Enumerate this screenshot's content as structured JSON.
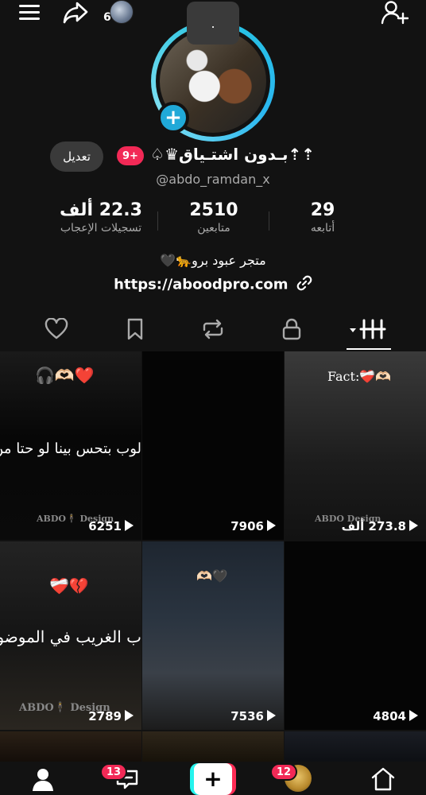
{
  "topbar": {
    "menu_icon": "hamburger-menu-icon",
    "share_icon": "share-arrow-icon",
    "visitor_count": "6",
    "add_user_icon": "add-user-icon"
  },
  "note_bubble": {
    "text": "."
  },
  "profile": {
    "display_name": "⇡⇡بـدون اشتـياق♛♤",
    "username": "@abdo_ramdan_x",
    "edit_label": "تعديل",
    "badge": "9+",
    "bio": "متجر عبود برو🐆🖤",
    "link": "https://aboodpro.com"
  },
  "stats": {
    "likes": {
      "value": "22.3 ألف",
      "label": "تسجيلات الإعجاب"
    },
    "followers": {
      "value": "2510",
      "label": "متابعين"
    },
    "following": {
      "value": "29",
      "label": "أتابعه"
    }
  },
  "tabs": [
    {
      "icon": "heart-icon"
    },
    {
      "icon": "bookmark-icon"
    },
    {
      "icon": "repost-icon"
    },
    {
      "icon": "lock-icon"
    },
    {
      "icon": "grid-videos-icon"
    }
  ],
  "videos": [
    {
      "overlay": "🎧🫶🏻❤️",
      "text": "لوب بتحس بينا لو حتا من",
      "watermark": "ABDO🕴 Design",
      "views": "6251"
    },
    {
      "overlay": "",
      "text": "",
      "watermark": "",
      "views": "7906"
    },
    {
      "overlay": "Fact:❤️‍🩹🫶🏻",
      "text": "",
      "watermark": "ABDO Design",
      "views": "273.8 ألف"
    },
    {
      "overlay": "❤️‍🩹💔",
      "text": "ب الغريب في الموضوع",
      "watermark": "ABDO🕴 Design",
      "views": "2789"
    },
    {
      "overlay": "🫶🏻🖤",
      "text": "",
      "watermark": "",
      "views": "7536"
    },
    {
      "overlay": "",
      "text": "",
      "watermark": "",
      "views": "4804"
    }
  ],
  "bottom_nav": {
    "profile_icon": "profile-icon",
    "inbox_badge": "13",
    "create_label": "+",
    "activity_badge": "12",
    "home_icon": "home-icon"
  },
  "colors": {
    "accent_pink": "#f22956",
    "accent_cyan": "#25f4ee",
    "ring": "#27c3e0",
    "background": "#121212"
  }
}
